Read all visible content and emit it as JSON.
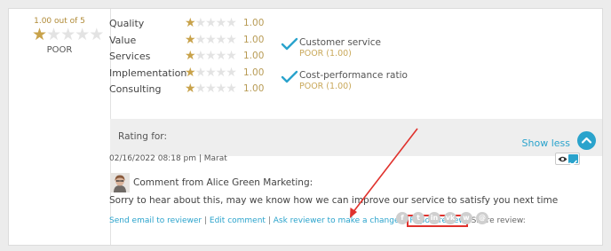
{
  "overall": {
    "score_text": "1.00 out of 5",
    "label": "POOR",
    "rating": 1,
    "max": 5
  },
  "metrics": [
    {
      "name": "Quality",
      "value": "1.00",
      "rating": 1
    },
    {
      "name": "Value",
      "value": "1.00",
      "rating": 1
    },
    {
      "name": "Services",
      "value": "1.00",
      "rating": 1
    },
    {
      "name": "Implementation",
      "value": "1.00",
      "rating": 1
    },
    {
      "name": "Consulting",
      "value": "1.00",
      "rating": 1
    }
  ],
  "summary": [
    {
      "title": "Customer service",
      "detail": "POOR (1.00)",
      "icon": "check-icon"
    },
    {
      "title": "Cost-performance ratio",
      "detail": "POOR (1.00)",
      "icon": "check-icon"
    }
  ],
  "rating_band": {
    "rating_for": "Rating for:",
    "toggle_label": "Show less"
  },
  "review": {
    "meta": "02/16/2022 08:18 pm | Marat",
    "comment_from": "Comment from Alice Green Marketing:",
    "comment_text": "Sorry to hear about this, may we know how we can improve our service to satisfy you next time"
  },
  "actions": {
    "send_email": "Send email to reviewer",
    "edit_comment": "Edit comment",
    "ask_change": "Ask reviewer to make a change",
    "report": "Report review",
    "separator": "|",
    "share_label": "Share review:"
  },
  "share_icons": [
    "facebook-icon",
    "twitter-icon",
    "linkedin-icon",
    "vk-icon",
    "whatsapp-icon",
    "email-icon"
  ],
  "colors": {
    "accent": "#2aa3cc",
    "star": "#c8a24a",
    "poor": "#c9a85a",
    "highlight": "#e0322d"
  }
}
